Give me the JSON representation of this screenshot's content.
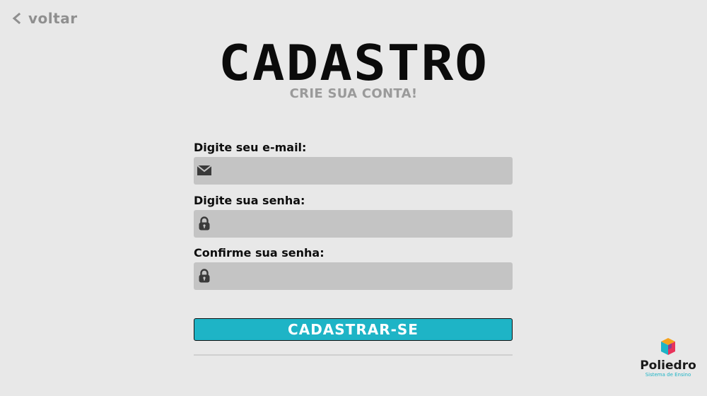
{
  "back": {
    "label": "voltar"
  },
  "header": {
    "title": "CADASTRO",
    "subtitle": "CRIE SUA CONTA!"
  },
  "form": {
    "email": {
      "label": "Digite seu e-mail:",
      "value": "",
      "placeholder": "",
      "icon": "envelope-icon"
    },
    "password": {
      "label": "Digite sua senha:",
      "value": "",
      "placeholder": "",
      "icon": "lock-icon"
    },
    "confirm": {
      "label": "Confirme sua senha:",
      "value": "",
      "placeholder": "",
      "icon": "lock-icon"
    },
    "submit_label": "CADASTRAR-SE"
  },
  "brand": {
    "name": "Poliedro",
    "tagline": "Sistema de Ensino"
  },
  "colors": {
    "background": "#e8e8e8",
    "field": "#c4c4c4",
    "accent": "#1eb4c6",
    "muted_text": "#9a9a9a"
  }
}
